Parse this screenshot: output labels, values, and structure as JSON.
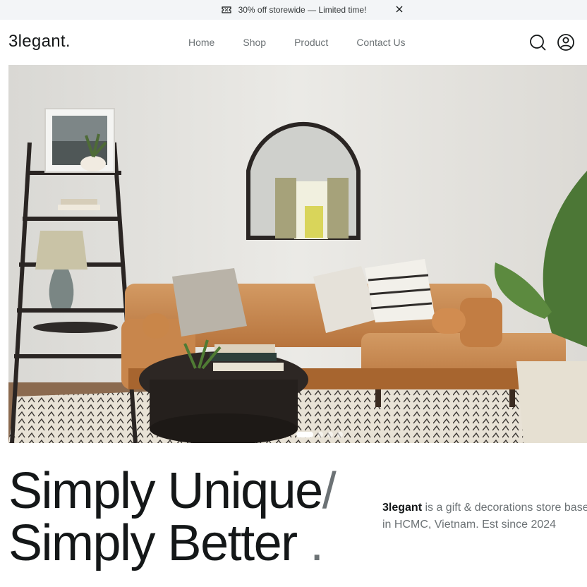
{
  "promo": {
    "text": "30% off storewide — Limited time!",
    "icons": {
      "ticket": "ticket-percent-icon",
      "close": "close-icon"
    }
  },
  "nav": {
    "logo": "3legant.",
    "links": [
      "Home",
      "Shop",
      "Product",
      "Contact Us"
    ],
    "icons": {
      "search": "search-icon",
      "account": "user-circle-icon"
    }
  },
  "hero": {
    "image": "living-room-photo",
    "slides_total": 4,
    "active_slide": 1
  },
  "headline": {
    "line1": "Simply Unique",
    "slash": "/",
    "line2": "Simply Better",
    "period": "."
  },
  "tagline": {
    "brand": "3legant",
    "line1_rest": " is a gift & decorations store based",
    "line2": "in HCMC, Vietnam. Est since 2024"
  },
  "colors": {
    "primary": "#141718",
    "muted": "#6c7275",
    "promo_bg": "#f3f5f7"
  }
}
